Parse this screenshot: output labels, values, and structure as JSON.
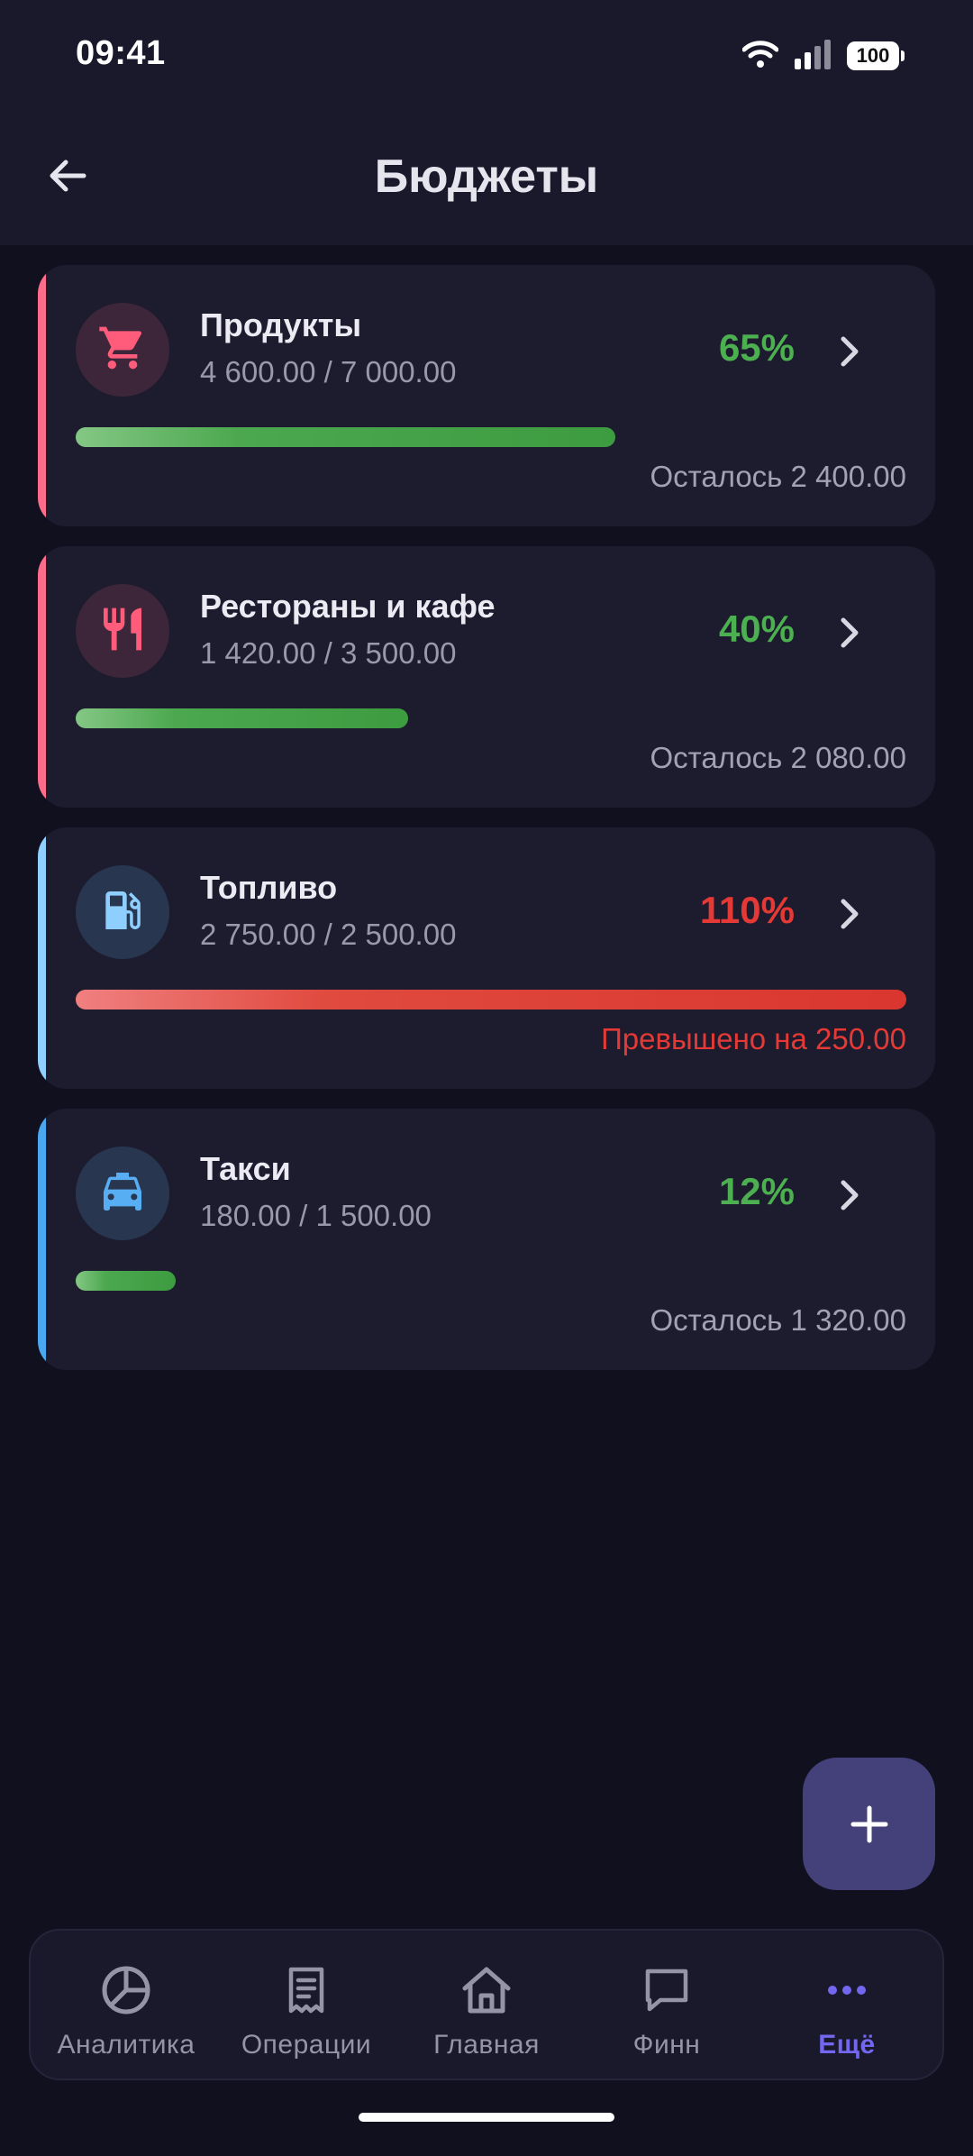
{
  "status": {
    "time": "09:41",
    "battery": "100"
  },
  "header": {
    "title": "Бюджеты"
  },
  "budgets": [
    {
      "name": "Продукты",
      "amount": "4 600.00 / 7 000.00",
      "percent": "65%",
      "progress": 0.65,
      "note": "Осталось 2 400.00",
      "status": "ok",
      "accent": "#ff6b8a",
      "icon": "cart-icon",
      "icon_color": "#ff5c7c",
      "icon_bg": "#3d2639"
    },
    {
      "name": "Рестораны и кафе",
      "amount": "1 420.00 / 3 500.00",
      "percent": "40%",
      "progress": 0.4,
      "note": "Осталось 2 080.00",
      "status": "ok",
      "accent": "#ff6b8a",
      "icon": "cutlery-icon",
      "icon_color": "#ff5c7c",
      "icon_bg": "#3d2639"
    },
    {
      "name": "Топливо",
      "amount": "2 750.00 / 2 500.00",
      "percent": "110%",
      "progress": 1.1,
      "note": "Превышено на 250.00",
      "status": "over",
      "accent": "#8fd0ff",
      "icon": "fuel-icon",
      "icon_color": "#8fcfff",
      "icon_bg": "#283650"
    },
    {
      "name": "Такси",
      "amount": "180.00 / 1 500.00",
      "percent": "12%",
      "progress": 0.12,
      "note": "Осталось 1 320.00",
      "status": "ok",
      "accent": "#4aa8f0",
      "icon": "taxi-icon",
      "icon_color": "#58aef2",
      "icon_bg": "#283650"
    }
  ],
  "colors": {
    "ok": "#4caf50",
    "over": "#e53935",
    "note_ok": "#a3a2b3",
    "note_over": "#e53935",
    "accent_purple": "#7367f0"
  },
  "nav": [
    {
      "label": "Аналитика",
      "icon": "pie-chart-icon",
      "active": false
    },
    {
      "label": "Операции",
      "icon": "receipt-icon",
      "active": false
    },
    {
      "label": "Главная",
      "icon": "home-icon",
      "active": false
    },
    {
      "label": "Финн",
      "icon": "chat-icon",
      "active": false
    },
    {
      "label": "Ещё",
      "icon": "more-icon",
      "active": true
    }
  ]
}
